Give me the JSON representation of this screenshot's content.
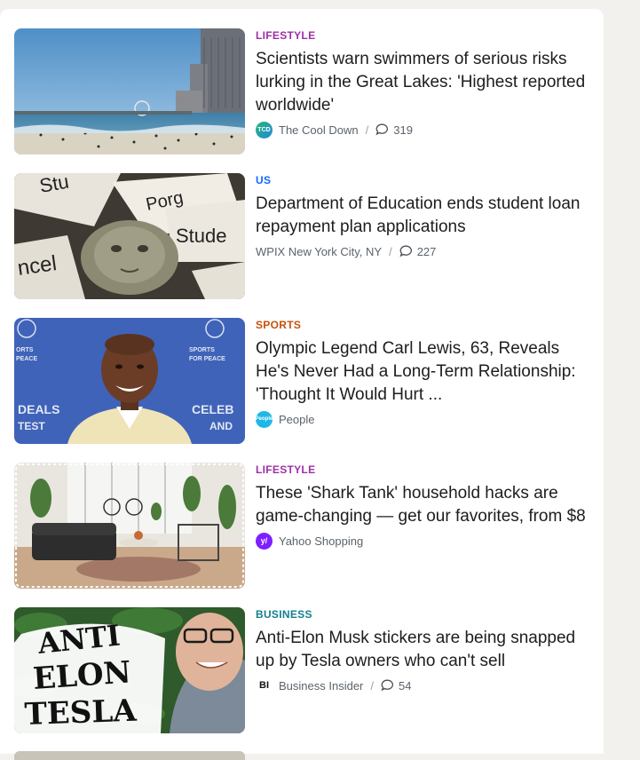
{
  "colors": {
    "lifestyle": "#a02fa7",
    "us": "#0f69ff",
    "sports": "#c7510a",
    "business": "#14808c"
  },
  "articles": [
    {
      "category": "LIFESTYLE",
      "headline": "Scientists warn swimmers of serious risks lurking in the Great Lakes: 'Highest reported worldwide'",
      "source": "The Cool Down",
      "source_logo_text": "TCD",
      "comments": "319",
      "image": "beach-city-skyline"
    },
    {
      "category": "US",
      "headline": "Department of Education ends student loan repayment plan applications",
      "source": "WPIX New York City, NY",
      "comments": "227",
      "image": "student-loan-money"
    },
    {
      "category": "SPORTS",
      "headline": "Olympic Legend Carl Lewis, 63, Reveals He's Never Had a Long-Term Relationship: 'Thought It Would Hurt ...",
      "source": "People",
      "source_logo_text": "People",
      "image": "carl-lewis-portrait"
    },
    {
      "category": "LIFESTYLE",
      "headline": "These 'Shark Tank' household hacks are game-changing — get our favorites, from $8",
      "source": "Yahoo Shopping",
      "source_logo_text": "y/",
      "image": "living-room"
    },
    {
      "category": "BUSINESS",
      "headline": "Anti-Elon Musk stickers are being snapped up by Tesla owners who can't sell",
      "source": "Business Insider",
      "source_logo_text": "BI",
      "comments": "54",
      "image": "anti-elon-sticker",
      "sticker_text": [
        "ANTI",
        "ELON",
        "TESLA"
      ]
    }
  ]
}
